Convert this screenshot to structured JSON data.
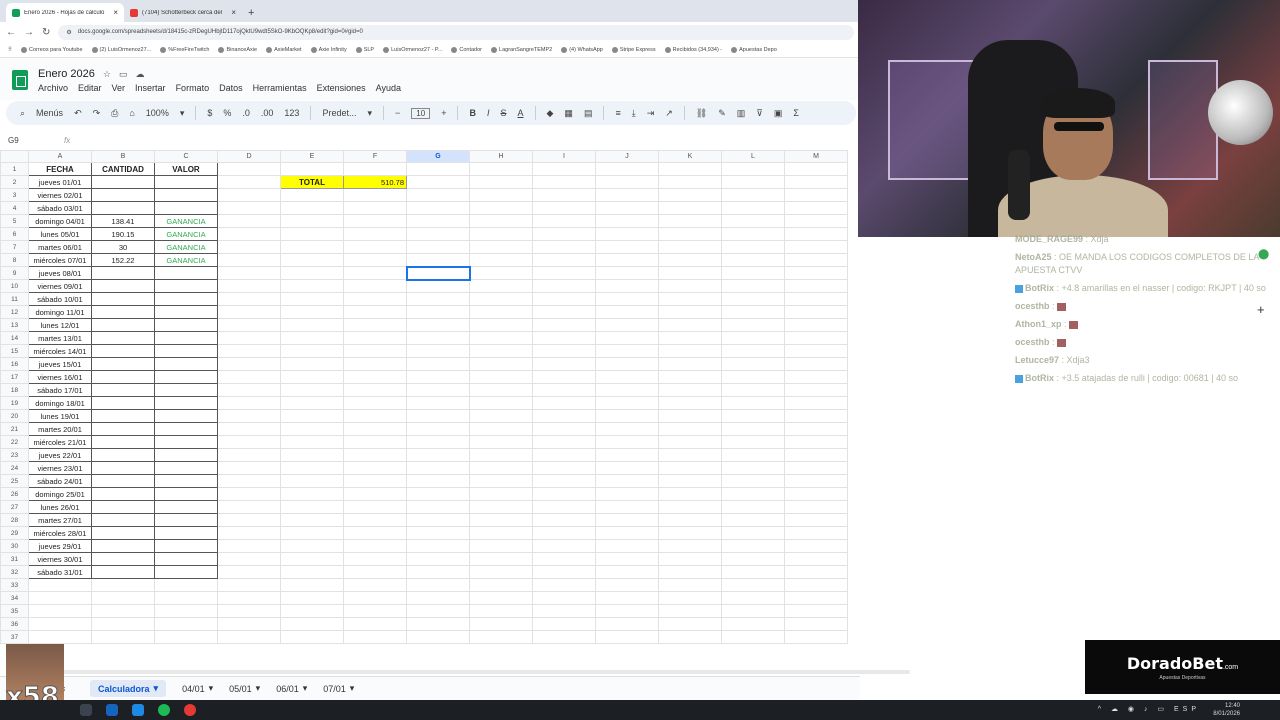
{
  "browser": {
    "tabs": [
      {
        "title": "Enero 2026 - Hojas de cálculo",
        "active": true,
        "color": "#0f9d58"
      },
      {
        "title": "(7104) Schotterbeck cerca del",
        "active": false,
        "color": "#e53935"
      }
    ],
    "url": "docs.google.com/spreadsheets/d/18415c-zRDegUHbjtD117ojQktU9wdt5SkO-9KbOQKp8/edit?gid=0#gid=0",
    "bookmarks": [
      "Correos para Youtube",
      "(2) LuisOrmenoz27...",
      "%FreeFireTwitch",
      "BinanceAxie",
      "AxieMarket",
      "Axie Infinity",
      "SLP",
      "LuisOrmenoz27 - P...",
      "Contador",
      "LagranSangreTEMP2",
      "(4) WhatsApp",
      "Stripe Express",
      "Recibidos (34,934) -",
      "Apuestas Depo"
    ]
  },
  "doc": {
    "title": "Enero 2026",
    "menu": [
      "Archivo",
      "Editar",
      "Ver",
      "Insertar",
      "Formato",
      "Datos",
      "Herramientas",
      "Extensiones",
      "Ayuda"
    ]
  },
  "toolbar": {
    "menus_label": "Menús",
    "zoom": "100%",
    "currency": "$",
    "percent": "%",
    "dec_dec": ".0",
    "dec_inc": ".00",
    "number_format": "123",
    "font": "Predet...",
    "font_size": "10"
  },
  "formula": {
    "namebox": "G9",
    "fx": "fx"
  },
  "columns": [
    "A",
    "B",
    "C",
    "D",
    "E",
    "F",
    "G",
    "H",
    "I",
    "J",
    "K",
    "L",
    "M"
  ],
  "headers": {
    "fecha": "FECHA",
    "cantidad": "CANTIDAD",
    "valor": "VALOR"
  },
  "total": {
    "label": "TOTAL",
    "value": "510.78"
  },
  "rows": [
    {
      "fecha": "jueves 01/01",
      "cantidad": "",
      "valor": ""
    },
    {
      "fecha": "viernes 02/01",
      "cantidad": "",
      "valor": ""
    },
    {
      "fecha": "sábado 03/01",
      "cantidad": "",
      "valor": ""
    },
    {
      "fecha": "domingo 04/01",
      "cantidad": "138.41",
      "valor": "GANANCIA"
    },
    {
      "fecha": "lunes 05/01",
      "cantidad": "190.15",
      "valor": "GANANCIA"
    },
    {
      "fecha": "martes 06/01",
      "cantidad": "30",
      "valor": "GANANCIA"
    },
    {
      "fecha": "miércoles 07/01",
      "cantidad": "152.22",
      "valor": "GANANCIA"
    },
    {
      "fecha": "jueves 08/01",
      "cantidad": "",
      "valor": ""
    },
    {
      "fecha": "viernes 09/01",
      "cantidad": "",
      "valor": ""
    },
    {
      "fecha": "sábado 10/01",
      "cantidad": "",
      "valor": ""
    },
    {
      "fecha": "domingo 11/01",
      "cantidad": "",
      "valor": ""
    },
    {
      "fecha": "lunes 12/01",
      "cantidad": "",
      "valor": ""
    },
    {
      "fecha": "martes 13/01",
      "cantidad": "",
      "valor": ""
    },
    {
      "fecha": "miércoles 14/01",
      "cantidad": "",
      "valor": ""
    },
    {
      "fecha": "jueves 15/01",
      "cantidad": "",
      "valor": ""
    },
    {
      "fecha": "viernes 16/01",
      "cantidad": "",
      "valor": ""
    },
    {
      "fecha": "sábado 17/01",
      "cantidad": "",
      "valor": ""
    },
    {
      "fecha": "domingo 18/01",
      "cantidad": "",
      "valor": ""
    },
    {
      "fecha": "lunes 19/01",
      "cantidad": "",
      "valor": ""
    },
    {
      "fecha": "martes 20/01",
      "cantidad": "",
      "valor": ""
    },
    {
      "fecha": "miércoles 21/01",
      "cantidad": "",
      "valor": ""
    },
    {
      "fecha": "jueves 22/01",
      "cantidad": "",
      "valor": ""
    },
    {
      "fecha": "viernes 23/01",
      "cantidad": "",
      "valor": ""
    },
    {
      "fecha": "sábado 24/01",
      "cantidad": "",
      "valor": ""
    },
    {
      "fecha": "domingo 25/01",
      "cantidad": "",
      "valor": ""
    },
    {
      "fecha": "lunes 26/01",
      "cantidad": "",
      "valor": ""
    },
    {
      "fecha": "martes 27/01",
      "cantidad": "",
      "valor": ""
    },
    {
      "fecha": "miércoles 28/01",
      "cantidad": "",
      "valor": ""
    },
    {
      "fecha": "jueves 29/01",
      "cantidad": "",
      "valor": ""
    },
    {
      "fecha": "viernes 30/01",
      "cantidad": "",
      "valor": ""
    },
    {
      "fecha": "sábado 31/01",
      "cantidad": "",
      "valor": ""
    }
  ],
  "extra_rows": [
    "33",
    "34",
    "35",
    "36",
    "37"
  ],
  "sheet_tabs": [
    "Calculadora",
    "04/01",
    "05/01",
    "06/01",
    "07/01"
  ],
  "chat": [
    {
      "user": "MODE_RAGE99",
      "msg": ": Xdja",
      "badge": false
    },
    {
      "user": "NetoA25",
      "msg": ": OE MANDA LOS CODIGOS COMPLETOS DE LA APUESTA CTVV",
      "badge": false
    },
    {
      "user": "BotRix",
      "msg": ": +4.8 amarillas en el nasser | codigo: RKJPT | 40 so",
      "badge": true
    },
    {
      "user": "ocesthb",
      "msg": ":",
      "badge": false
    },
    {
      "user": "Athon1_xp",
      "msg": ":",
      "badge": false
    },
    {
      "user": "ocesthb",
      "msg": ":",
      "badge": false
    },
    {
      "user": "Letucce97",
      "msg": ": Xdja3",
      "badge": false
    },
    {
      "user": "BotRix",
      "msg": ": +3.5 atajadas de rulli | codigo: 00681 | 40 so",
      "badge": true
    }
  ],
  "brand": {
    "name": "DoradoBet",
    "suffix": ".com",
    "tagline": "Apuestas Deportivas"
  },
  "emote_counter": "x58",
  "taskbar": {
    "time": "12:40",
    "date": "8/01/2026",
    "lang": "ESP"
  }
}
